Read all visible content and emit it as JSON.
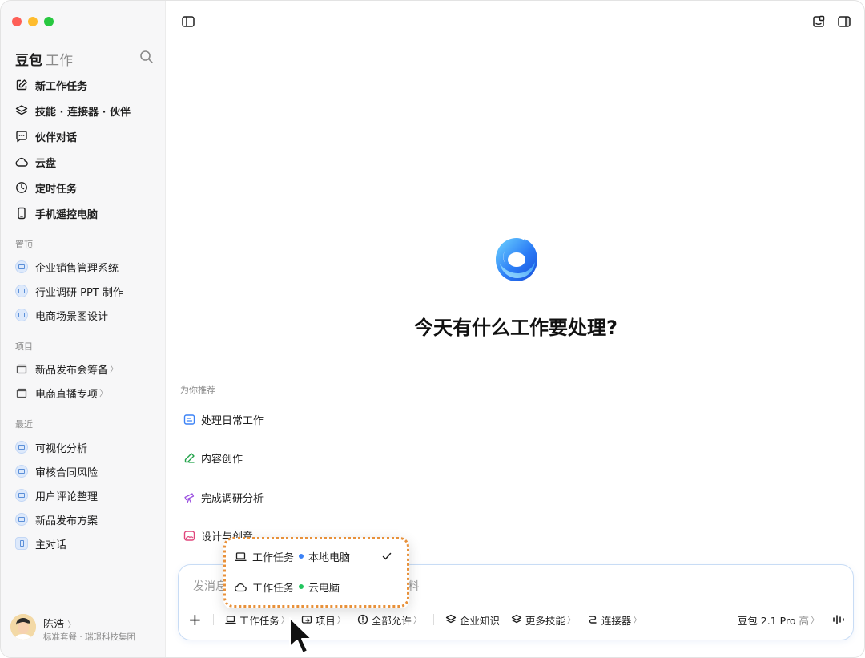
{
  "sidebar": {
    "brand": "豆包",
    "brand_sub": "工作",
    "nav": [
      {
        "label": "新工作任务",
        "icon": "edit-icon"
      },
      {
        "label": "技能 · 连接器 · 伙伴",
        "icon": "layers-icon"
      },
      {
        "label": "伙伴对话",
        "icon": "chat-icon"
      },
      {
        "label": "云盘",
        "icon": "cloud-icon"
      },
      {
        "label": "定时任务",
        "icon": "clock-icon"
      },
      {
        "label": "手机遥控电脑",
        "icon": "phone-icon"
      }
    ],
    "pinned_label": "置顶",
    "pinned": [
      "企业销售管理系统",
      "行业调研 PPT 制作",
      "电商场景图设计"
    ],
    "projects_label": "项目",
    "projects": [
      "新品发布会筹备",
      "电商直播专项"
    ],
    "recent_label": "最近",
    "recent": [
      "可视化分析",
      "审核合同风险",
      "用户评论整理",
      "新品发布方案",
      "主对话"
    ],
    "user": {
      "name": "陈浩",
      "plan": "标准套餐 · 瑞璟科技集团"
    }
  },
  "main": {
    "headline": "今天有什么工作要处理?",
    "reco_label": "为你推荐",
    "reco": [
      {
        "label": "处理日常工作",
        "icon": "briefcase-icon",
        "color": "#3b82f6"
      },
      {
        "label": "内容创作",
        "icon": "pen-icon",
        "color": "#22a34a"
      },
      {
        "label": "完成调研分析",
        "icon": "telescope-icon",
        "color": "#9b51e0"
      },
      {
        "label": "设计与创意",
        "icon": "image-icon",
        "color": "#e0457b"
      }
    ]
  },
  "composer": {
    "placeholder": "发消息或输入\"/\"选择技能、\"@\"快速引用资料",
    "task_mode": "工作任务",
    "project": "项目",
    "permission": "全部允许",
    "knowledge": "企业知识",
    "skills": "更多技能",
    "connector": "连接器",
    "model": "豆包 2.1 Pro",
    "model_level": "高"
  },
  "popup": {
    "items": [
      {
        "mode": "工作任务",
        "target": "本地电脑",
        "dot_color": "#3b82f6",
        "selected": true
      },
      {
        "mode": "工作任务",
        "target": "云电脑",
        "dot_color": "#22c55e",
        "selected": false
      }
    ]
  },
  "colors": {
    "accent": "#e8913a",
    "brand_blue": "#2b7cf6"
  }
}
